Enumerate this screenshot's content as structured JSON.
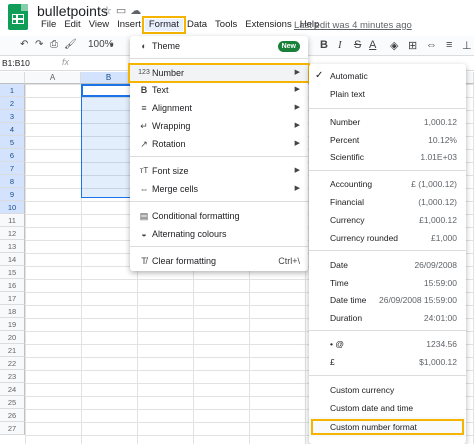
{
  "app": {
    "title": "bulletpoints",
    "last_edit": "Last edit was 4 minutes ago"
  },
  "menubar": [
    "File",
    "Edit",
    "View",
    "Insert",
    "Format",
    "Data",
    "Tools",
    "Extensions",
    "Help"
  ],
  "toolbar": {
    "zoom": "100%"
  },
  "formula_bar": {
    "name_box": "B1:B10",
    "fx": "fx"
  },
  "columns": [
    "A",
    "B"
  ],
  "rows": [
    "1",
    "2",
    "3",
    "4",
    "5",
    "6",
    "7",
    "8",
    "9",
    "10",
    "11",
    "12",
    "13",
    "14",
    "15",
    "16",
    "17",
    "18",
    "19",
    "20",
    "21",
    "22",
    "23",
    "24",
    "25",
    "26",
    "27"
  ],
  "format_menu": {
    "theme": {
      "label": "Theme",
      "badge": "New",
      "icon": "palette-icon"
    },
    "number": {
      "label": "Number",
      "icon": "123"
    },
    "text": {
      "label": "Text",
      "icon": "B"
    },
    "alignment": {
      "label": "Alignment"
    },
    "wrapping": {
      "label": "Wrapping"
    },
    "rotation": {
      "label": "Rotation"
    },
    "font_size": {
      "label": "Font size"
    },
    "merge_cells": {
      "label": "Merge cells"
    },
    "conditional_formatting": {
      "label": "Conditional formatting"
    },
    "alternating_colours": {
      "label": "Alternating colours"
    },
    "clear_formatting": {
      "label": "Clear formatting",
      "shortcut": "Ctrl+\\"
    }
  },
  "number_submenu": {
    "automatic": "Automatic",
    "plain_text": "Plain text",
    "number": {
      "label": "Number",
      "example": "1,000.12"
    },
    "percent": {
      "label": "Percent",
      "example": "10.12%"
    },
    "scientific": {
      "label": "Scientific",
      "example": "1.01E+03"
    },
    "accounting": {
      "label": "Accounting",
      "example": "£ (1,000.12)"
    },
    "financial": {
      "label": "Financial",
      "example": "(1,000.12)"
    },
    "currency": {
      "label": "Currency",
      "example": "£1,000.12"
    },
    "currency_rounded": {
      "label": "Currency rounded",
      "example": "£1,000"
    },
    "date": {
      "label": "Date",
      "example": "26/09/2008"
    },
    "time": {
      "label": "Time",
      "example": "15:59:00"
    },
    "date_time": {
      "label": "Date time",
      "example": "26/09/2008 15:59:00"
    },
    "duration": {
      "label": "Duration",
      "example": "24:01:00"
    },
    "custom1": {
      "label": "• @",
      "example": "1234.56"
    },
    "custom2": {
      "label": "£",
      "example": "$1,000.12"
    },
    "custom_currency": "Custom currency",
    "custom_date_time": "Custom date and time",
    "custom_number_format": "Custom number format"
  }
}
